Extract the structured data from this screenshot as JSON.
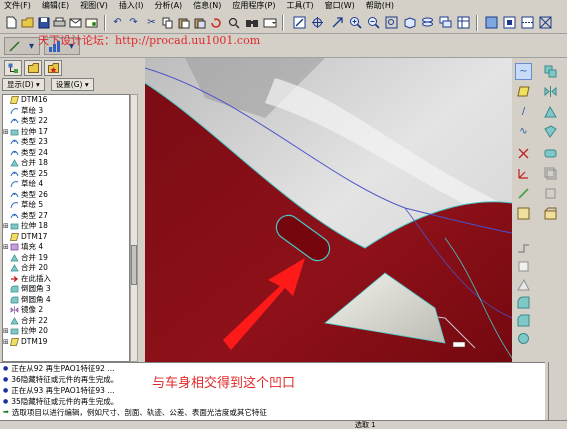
{
  "menu": {
    "items": [
      "文件(F)",
      "编辑(E)",
      "视图(V)",
      "插入(I)",
      "分析(A)",
      "信息(N)",
      "应用程序(P)",
      "工具(T)",
      "窗口(W)",
      "帮助(H)"
    ]
  },
  "watermark": "天下设计论坛：http://procad.uu1001.com",
  "model_tree": {
    "display_label": "显示(D)",
    "settings_label": "设置(G)",
    "items": [
      {
        "label": "DTM16",
        "icon": "datum-plane-icon",
        "expand": ""
      },
      {
        "label": "草绘 3",
        "icon": "sketch-icon",
        "expand": ""
      },
      {
        "label": "类型 22",
        "icon": "style-feature-icon",
        "expand": ""
      },
      {
        "label": "拉伸 17",
        "icon": "extrude-icon",
        "expand": "+"
      },
      {
        "label": "类型 23",
        "icon": "style-feature-icon",
        "expand": ""
      },
      {
        "label": "类型 24",
        "icon": "style-feature-icon",
        "expand": ""
      },
      {
        "label": "合并 18",
        "icon": "merge-icon",
        "expand": ""
      },
      {
        "label": "类型 25",
        "icon": "style-feature-icon",
        "expand": ""
      },
      {
        "label": "草绘 4",
        "icon": "sketch-icon",
        "expand": ""
      },
      {
        "label": "类型 26",
        "icon": "style-feature-icon",
        "expand": ""
      },
      {
        "label": "草绘 5",
        "icon": "sketch-icon",
        "expand": ""
      },
      {
        "label": "类型 27",
        "icon": "style-feature-icon",
        "expand": ""
      },
      {
        "label": "拉伸 18",
        "icon": "extrude-icon",
        "expand": "+"
      },
      {
        "label": "DTM17",
        "icon": "datum-plane-icon",
        "expand": ""
      },
      {
        "label": "填充 4",
        "icon": "fill-icon",
        "expand": "+"
      },
      {
        "label": "合并 19",
        "icon": "merge-icon",
        "expand": ""
      },
      {
        "label": "合并 20",
        "icon": "merge-icon",
        "expand": ""
      },
      {
        "label": "在此插入",
        "icon": "insert-here-icon",
        "expand": ""
      },
      {
        "label": "倒圆角 3",
        "icon": "round-icon",
        "expand": ""
      },
      {
        "label": "倒圆角 4",
        "icon": "round-icon",
        "expand": ""
      },
      {
        "label": "镜像 2",
        "icon": "mirror-icon",
        "expand": ""
      },
      {
        "label": "合并 22",
        "icon": "merge-icon",
        "expand": ""
      },
      {
        "label": "拉伸 20",
        "icon": "extrude-icon",
        "expand": "+"
      },
      {
        "label": "DTM19",
        "icon": "datum-plane-icon",
        "expand": "+"
      }
    ]
  },
  "messages": [
    {
      "text": "正在从92 再生PAO1特征92 ...",
      "kind": "info"
    },
    {
      "text": "36隐藏特征或元件的再生完成。",
      "kind": "info"
    },
    {
      "text": "正在从93 再生PAO1特征93 ...",
      "kind": "info"
    },
    {
      "text": "35隐藏特征或元件的再生完成。",
      "kind": "info"
    },
    {
      "text": "选取项目以进行编辑，例如尺寸、剖面、轨迹、公差、表面光洁度或其它特征",
      "kind": "prompt"
    }
  ],
  "annotation": "与车身相交得到这个凹口",
  "status": {
    "selection": "选取 1"
  },
  "colors": {
    "body_red": "#8a1018",
    "annotation_red": "#e02828",
    "edge_cyan": "#48c8c8",
    "message_blue": "#1b2fa0"
  }
}
